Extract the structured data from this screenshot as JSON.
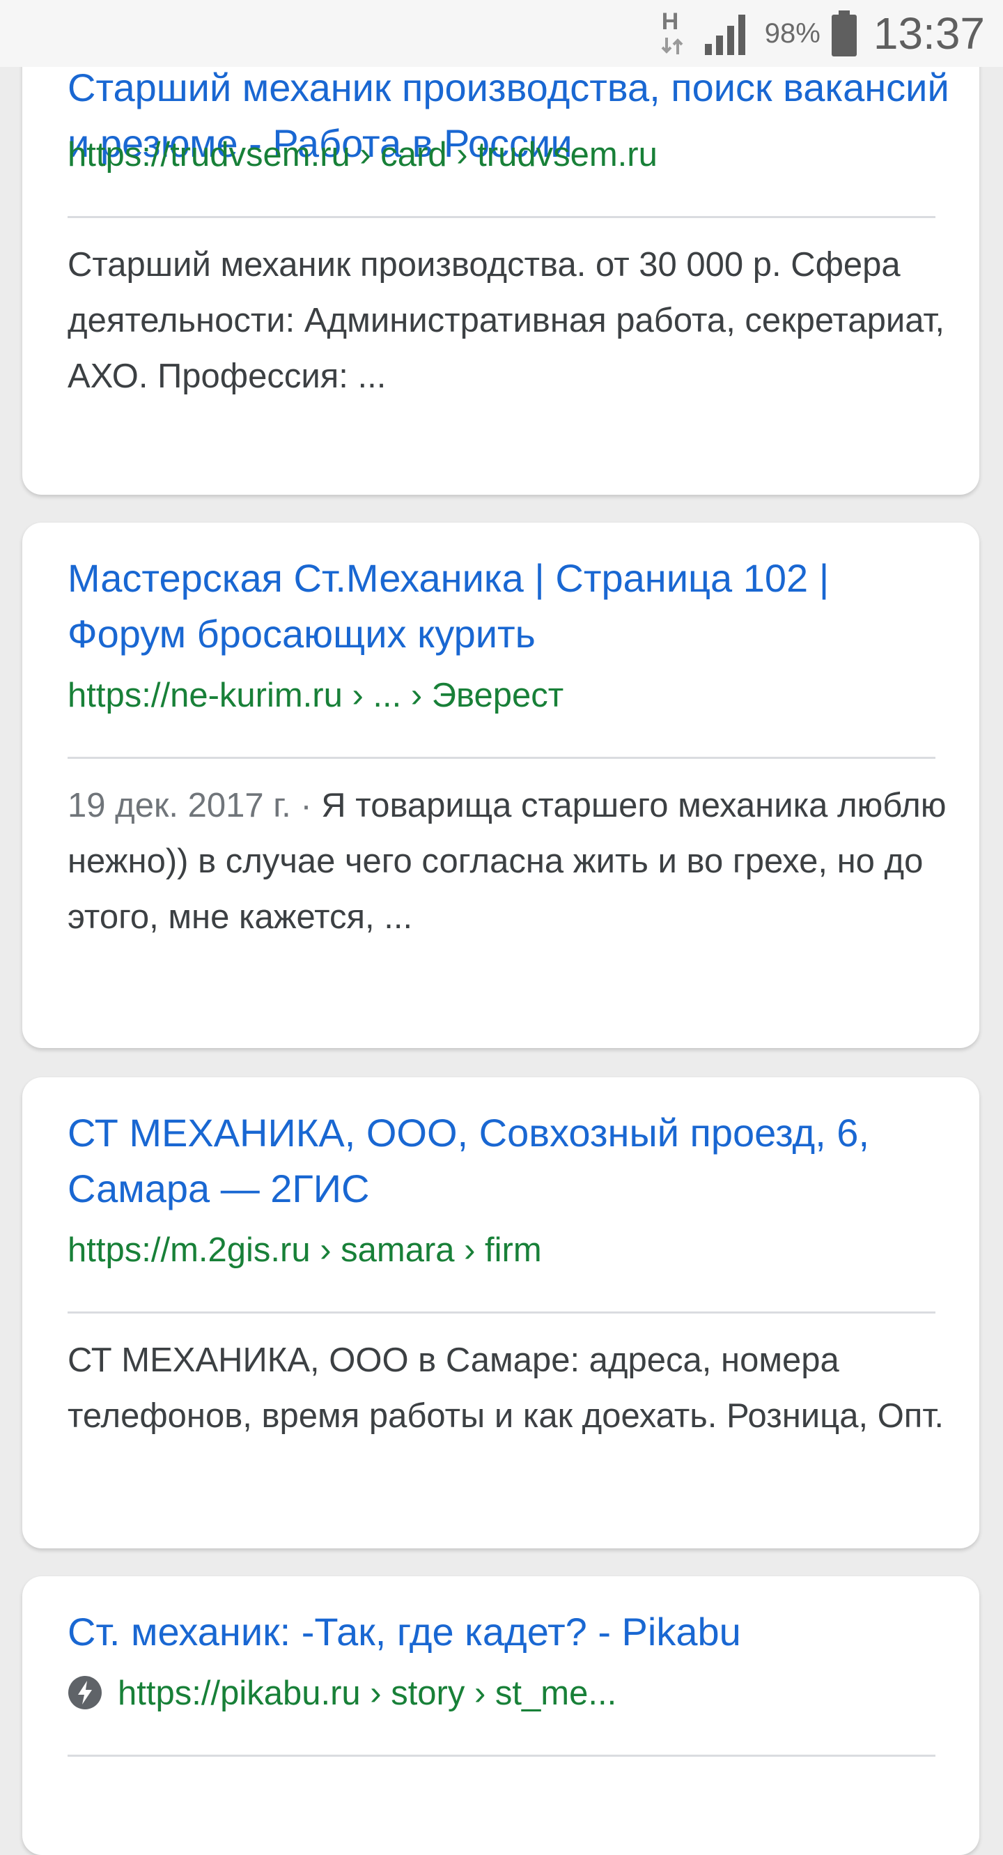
{
  "status_bar": {
    "network_label": "H",
    "battery_percent": "98%",
    "time": "13:37",
    "battery_level": 0.98,
    "signal_bars": 4
  },
  "results": [
    {
      "title": "Старший механик производства, поиск вакансий и резюме - Работа в России",
      "url": "https://trudvsem.ru › card › trudvsem.ru",
      "snippet_date": "",
      "snippet": "Старший механик производства. от 30 000 р. Сфера деятельности: Административная работа, секретариат, АХО. Профессия: ..."
    },
    {
      "title": "Мастерская Ст.Механика | Страница 102 | Форум бросающих курить",
      "url": "https://ne-kurim.ru › ... › Эверест",
      "snippet_date": "19 дек. 2017 г. · ",
      "snippet": "Я товарища старшего механика люблю нежно)) в случае чего согласна жить и во грехе, но до этого, мне кажется, ..."
    },
    {
      "title": "СТ МЕХАНИКА, ООО, Совхозный проезд, 6, Самара — 2ГИС",
      "url": "https://m.2gis.ru › samara › firm",
      "snippet_date": "",
      "snippet": "СТ МЕХАНИКА, ООО в Самаре: адреса, номера телефонов, время работы и как доехать. Розница, Опт."
    },
    {
      "title": "Ст. механик: -Так, где кадет? - Pikabu",
      "url": "https://pikabu.ru › story › st_me...",
      "amp_icon": "amp-lightning-icon"
    }
  ],
  "colors": {
    "title": "#1967d2",
    "url": "#188038",
    "snippet": "#3c4043",
    "date": "#70757a"
  }
}
